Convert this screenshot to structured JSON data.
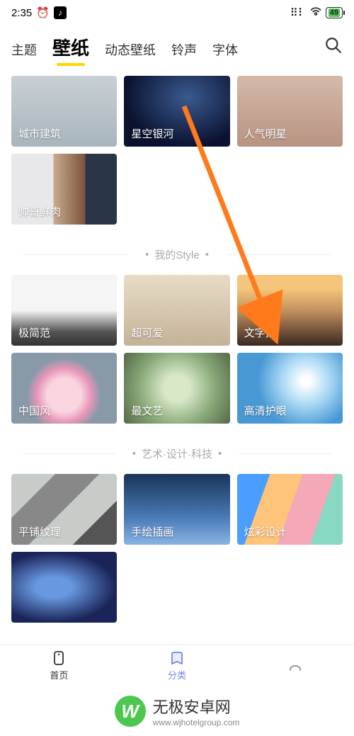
{
  "status": {
    "time": "2:35",
    "battery": "49"
  },
  "tabs": [
    {
      "label": "主题"
    },
    {
      "label": "壁纸"
    },
    {
      "label": "动态壁纸"
    },
    {
      "label": "铃声"
    },
    {
      "label": "字体"
    }
  ],
  "active_tab": 1,
  "topGrid": [
    {
      "label": "城市建筑",
      "bg": "bg-city"
    },
    {
      "label": "星空银河",
      "bg": "bg-galaxy"
    },
    {
      "label": "人气明星",
      "bg": "bg-star"
    },
    {
      "label": "帅哥鲜肉",
      "bg": "bg-man"
    }
  ],
  "section1": {
    "title": "我的Style"
  },
  "grid1": [
    {
      "label": "极简范",
      "bg": "bg-minimal"
    },
    {
      "label": "超可爱",
      "bg": "bg-cute"
    },
    {
      "label": "文字控",
      "bg": "bg-text"
    },
    {
      "label": "中国风",
      "bg": "bg-china"
    },
    {
      "label": "最文艺",
      "bg": "bg-arty"
    },
    {
      "label": "高清护眼",
      "bg": "bg-eye"
    }
  ],
  "section2": {
    "title": "艺术·设计·科技"
  },
  "grid2": [
    {
      "label": "平铺纹理",
      "bg": "bg-tile"
    },
    {
      "label": "手绘插画",
      "bg": "bg-illust"
    },
    {
      "label": "炫彩设计",
      "bg": "bg-color"
    },
    {
      "label": "",
      "bg": "bg-last"
    }
  ],
  "nav": {
    "home": "首页",
    "category": "分类"
  },
  "watermark": {
    "brand": "无极安卓网",
    "url": "www.wjhotelgroup.com"
  }
}
